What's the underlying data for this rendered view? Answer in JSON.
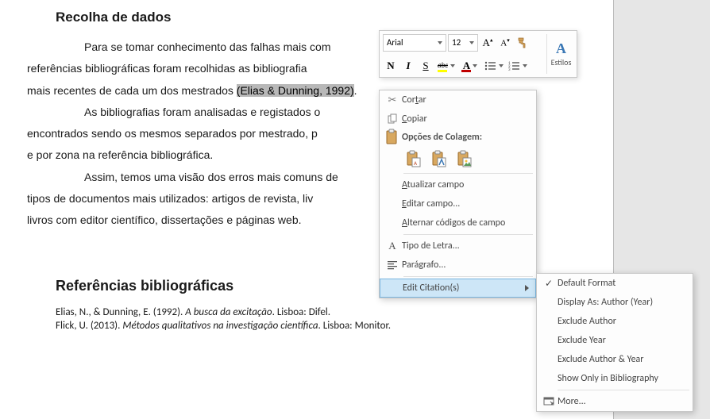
{
  "doc": {
    "heading1": "Recolha de dados",
    "p1a": "Para se tomar conhecimento das falhas mais com",
    "p1b": "referências bibliográficas foram recolhidas as bibliografia",
    "p1c": "mais recentes de cada um dos mestrados ",
    "citation": "(Elias & Dunning, 1992)",
    "p2a": "As bibliografias foram analisadas e registados o",
    "p2b": "encontrados sendo os mesmos separados por mestrado, p",
    "p2c": "e por zona na referência bibliográfica.",
    "p3a": "Assim, temos uma visão dos erros mais comuns de",
    "p3b": "tipos de documentos mais utilizados: artigos de revista, liv",
    "p3c": "livros com editor científico, dissertações e páginas web.",
    "heading2": "Referências bibliográficas",
    "ref1_a": "Elias, N., & Dunning, E. (1992). ",
    "ref1_i": "A busca da excitação",
    "ref1_b": ". Lisboa: Difel.",
    "ref2_a": "Flick, U. (2013). ",
    "ref2_i": "Métodos qualitativos na investigação científica",
    "ref2_b": ". Lisboa: Monitor."
  },
  "toolbar": {
    "font": "Arial",
    "size": "12",
    "bold": "N",
    "italic": "I",
    "underline": "S",
    "strike": "abc",
    "styles": "Estilos"
  },
  "ctx": {
    "cut": "Cortar",
    "copy": "Copiar",
    "paste_header": "Opções de Colagem:",
    "update": "Atualizar campo",
    "edit_field": "Editar campo...",
    "toggle_codes": "Alternar códigos de campo",
    "font_dlg": "Tipo de Letra...",
    "paragraph_dlg": "Parágrafo...",
    "edit_citation": "Edit Citation(s)"
  },
  "sub": {
    "default_fmt": "Default Format",
    "display_as": "Display As: Author (Year)",
    "excl_author": "Exclude Author",
    "excl_year": "Exclude Year",
    "excl_both": "Exclude Author & Year",
    "show_only": "Show Only in Bibliography",
    "more": "More..."
  }
}
